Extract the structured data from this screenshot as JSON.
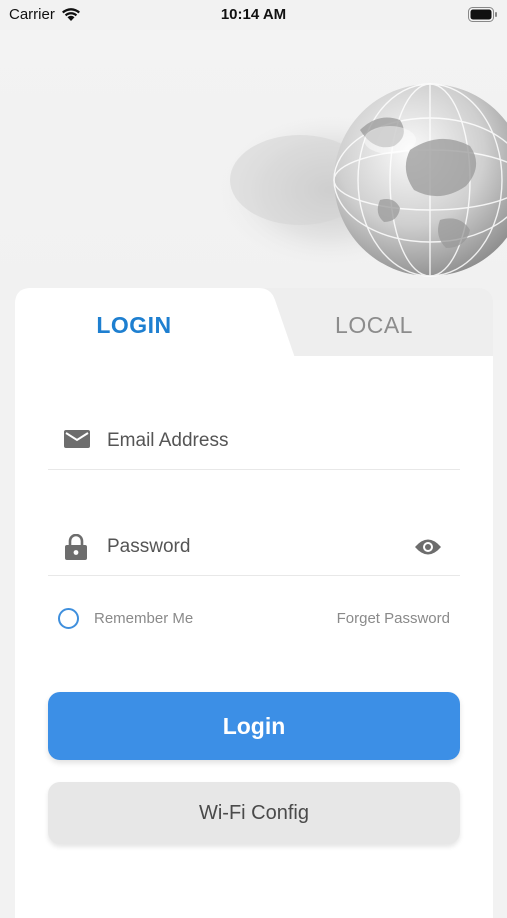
{
  "status_bar": {
    "carrier": "Carrier",
    "time": "10:14 AM"
  },
  "tabs": [
    {
      "label": "LOGIN",
      "active": true
    },
    {
      "label": "LOCAL",
      "active": false
    }
  ],
  "form": {
    "email": {
      "placeholder": "Email Address",
      "icon": "mail-icon"
    },
    "password": {
      "placeholder": "Password",
      "icon": "lock-icon",
      "toggle_icon": "eye-icon"
    },
    "remember_label": "Remember Me",
    "remember_checked": false,
    "forgot_label": "Forget Password"
  },
  "buttons": {
    "login": "Login",
    "wifi_config": "Wi-Fi Config"
  },
  "colors": {
    "accent": "#3c8fe6",
    "tab_active": "#1e7fd0",
    "muted": "#8c8c8c"
  }
}
